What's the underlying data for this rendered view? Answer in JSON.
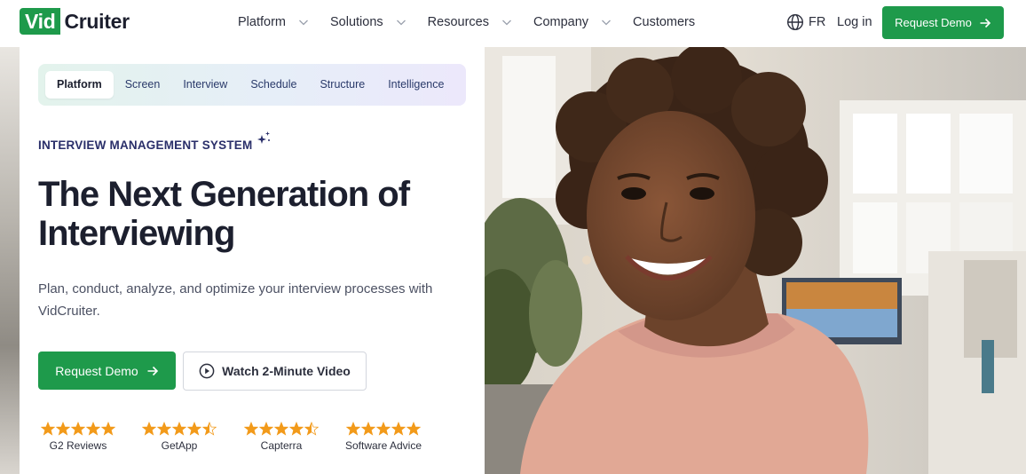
{
  "brand": {
    "logo_part1": "Vid",
    "logo_part2": "Cruiter",
    "accent_color": "#1e9a4b"
  },
  "header": {
    "nav": [
      {
        "label": "Platform",
        "has_dropdown": true
      },
      {
        "label": "Solutions",
        "has_dropdown": true
      },
      {
        "label": "Resources",
        "has_dropdown": true
      },
      {
        "label": "Company",
        "has_dropdown": true
      },
      {
        "label": "Customers",
        "has_dropdown": false
      }
    ],
    "language": "FR",
    "login": "Log in",
    "cta": "Request Demo"
  },
  "hero": {
    "tabs": [
      "Platform",
      "Screen",
      "Interview",
      "Schedule",
      "Structure",
      "Intelligence"
    ],
    "active_tab": "Platform",
    "eyebrow": "INTERVIEW MANAGEMENT SYSTEM",
    "headline": "The Next Generation of Interviewing",
    "subtext": "Plan, conduct, analyze, and optimize your interview processes with VidCruiter.",
    "primary_cta": "Request Demo",
    "secondary_cta": "Watch 2-Minute Video",
    "photo_alt": "smiling woman in pink sweater in an office",
    "ratings": [
      {
        "label": "G2 Reviews",
        "stars": 5
      },
      {
        "label": "GetApp",
        "stars": 4.5
      },
      {
        "label": "Capterra",
        "stars": 4.5
      },
      {
        "label": "Software Advice",
        "stars": 5
      }
    ],
    "star_color": "#f29a1a"
  }
}
